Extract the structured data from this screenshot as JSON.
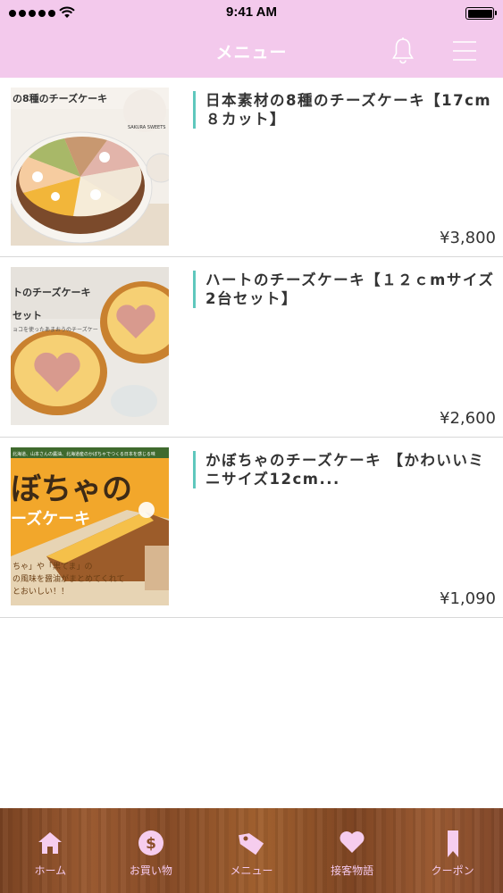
{
  "status": {
    "time": "9:41 AM"
  },
  "nav": {
    "title": "メニュー"
  },
  "items": [
    {
      "title": "日本素材の8種のチーズケーキ【17cm８カット】",
      "price": "¥3,800",
      "image_text": [
        "の8種のチーズケーキ",
        "SAKURA SWEETS"
      ]
    },
    {
      "title": "ハートのチーズケーキ【１２ｃmサイズ2台セット】",
      "price": "¥2,600",
      "image_text": [
        "トのチーズケーキ",
        "セット",
        "ョコを使ったあまおうのチーズケー"
      ]
    },
    {
      "title": "かぼちゃのチーズケーキ 【かわいいミニサイズ12cm...",
      "price": "¥1,090",
      "image_text": [
        "ぼちゃの",
        "ーズケーキ",
        "北海道、山本さんの醤油、北海道産のかぼちゃでつくる日本を感じる味",
        "ちゃ」や「黒てま」の",
        "の風味を醤油がまとめてくれて",
        "とおいしい！！"
      ]
    }
  ],
  "tabs": [
    {
      "label": "ホーム",
      "icon": "home-icon"
    },
    {
      "label": "お買い物",
      "icon": "dollar-icon"
    },
    {
      "label": "メニュー",
      "icon": "tag-icon"
    },
    {
      "label": "接客物語",
      "icon": "heart-icon"
    },
    {
      "label": "クーポン",
      "icon": "bookmark-icon"
    }
  ],
  "colors": {
    "header": "#f3c9ec",
    "accent_bar": "#5fc7bd",
    "tab_icon": "#f6cdee",
    "wood": "#8b4e29"
  }
}
